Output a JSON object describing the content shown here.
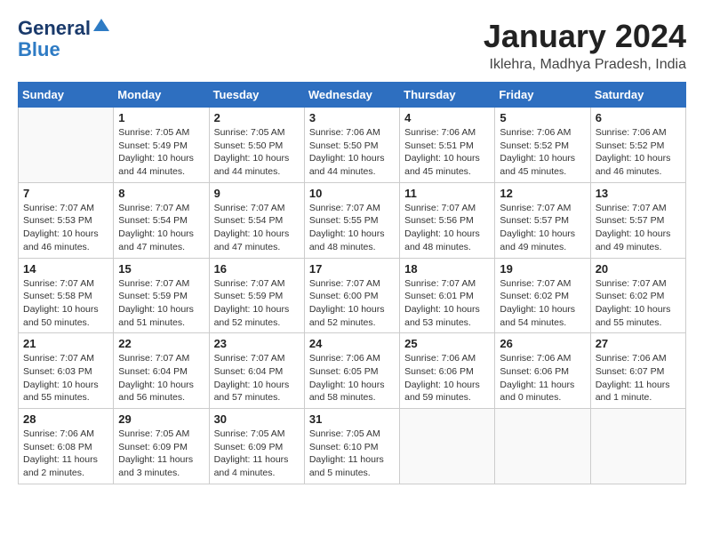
{
  "logo": {
    "line1": "General",
    "line2": "Blue"
  },
  "title": "January 2024",
  "subtitle": "Iklehra, Madhya Pradesh, India",
  "days": [
    "Sunday",
    "Monday",
    "Tuesday",
    "Wednesday",
    "Thursday",
    "Friday",
    "Saturday"
  ],
  "weeks": [
    [
      {
        "date": "",
        "sunrise": "",
        "sunset": "",
        "daylight": ""
      },
      {
        "date": "1",
        "sunrise": "Sunrise: 7:05 AM",
        "sunset": "Sunset: 5:49 PM",
        "daylight": "Daylight: 10 hours and 44 minutes."
      },
      {
        "date": "2",
        "sunrise": "Sunrise: 7:05 AM",
        "sunset": "Sunset: 5:50 PM",
        "daylight": "Daylight: 10 hours and 44 minutes."
      },
      {
        "date": "3",
        "sunrise": "Sunrise: 7:06 AM",
        "sunset": "Sunset: 5:50 PM",
        "daylight": "Daylight: 10 hours and 44 minutes."
      },
      {
        "date": "4",
        "sunrise": "Sunrise: 7:06 AM",
        "sunset": "Sunset: 5:51 PM",
        "daylight": "Daylight: 10 hours and 45 minutes."
      },
      {
        "date": "5",
        "sunrise": "Sunrise: 7:06 AM",
        "sunset": "Sunset: 5:52 PM",
        "daylight": "Daylight: 10 hours and 45 minutes."
      },
      {
        "date": "6",
        "sunrise": "Sunrise: 7:06 AM",
        "sunset": "Sunset: 5:52 PM",
        "daylight": "Daylight: 10 hours and 46 minutes."
      }
    ],
    [
      {
        "date": "7",
        "sunrise": "Sunrise: 7:07 AM",
        "sunset": "Sunset: 5:53 PM",
        "daylight": "Daylight: 10 hours and 46 minutes."
      },
      {
        "date": "8",
        "sunrise": "Sunrise: 7:07 AM",
        "sunset": "Sunset: 5:54 PM",
        "daylight": "Daylight: 10 hours and 47 minutes."
      },
      {
        "date": "9",
        "sunrise": "Sunrise: 7:07 AM",
        "sunset": "Sunset: 5:54 PM",
        "daylight": "Daylight: 10 hours and 47 minutes."
      },
      {
        "date": "10",
        "sunrise": "Sunrise: 7:07 AM",
        "sunset": "Sunset: 5:55 PM",
        "daylight": "Daylight: 10 hours and 48 minutes."
      },
      {
        "date": "11",
        "sunrise": "Sunrise: 7:07 AM",
        "sunset": "Sunset: 5:56 PM",
        "daylight": "Daylight: 10 hours and 48 minutes."
      },
      {
        "date": "12",
        "sunrise": "Sunrise: 7:07 AM",
        "sunset": "Sunset: 5:57 PM",
        "daylight": "Daylight: 10 hours and 49 minutes."
      },
      {
        "date": "13",
        "sunrise": "Sunrise: 7:07 AM",
        "sunset": "Sunset: 5:57 PM",
        "daylight": "Daylight: 10 hours and 49 minutes."
      }
    ],
    [
      {
        "date": "14",
        "sunrise": "Sunrise: 7:07 AM",
        "sunset": "Sunset: 5:58 PM",
        "daylight": "Daylight: 10 hours and 50 minutes."
      },
      {
        "date": "15",
        "sunrise": "Sunrise: 7:07 AM",
        "sunset": "Sunset: 5:59 PM",
        "daylight": "Daylight: 10 hours and 51 minutes."
      },
      {
        "date": "16",
        "sunrise": "Sunrise: 7:07 AM",
        "sunset": "Sunset: 5:59 PM",
        "daylight": "Daylight: 10 hours and 52 minutes."
      },
      {
        "date": "17",
        "sunrise": "Sunrise: 7:07 AM",
        "sunset": "Sunset: 6:00 PM",
        "daylight": "Daylight: 10 hours and 52 minutes."
      },
      {
        "date": "18",
        "sunrise": "Sunrise: 7:07 AM",
        "sunset": "Sunset: 6:01 PM",
        "daylight": "Daylight: 10 hours and 53 minutes."
      },
      {
        "date": "19",
        "sunrise": "Sunrise: 7:07 AM",
        "sunset": "Sunset: 6:02 PM",
        "daylight": "Daylight: 10 hours and 54 minutes."
      },
      {
        "date": "20",
        "sunrise": "Sunrise: 7:07 AM",
        "sunset": "Sunset: 6:02 PM",
        "daylight": "Daylight: 10 hours and 55 minutes."
      }
    ],
    [
      {
        "date": "21",
        "sunrise": "Sunrise: 7:07 AM",
        "sunset": "Sunset: 6:03 PM",
        "daylight": "Daylight: 10 hours and 55 minutes."
      },
      {
        "date": "22",
        "sunrise": "Sunrise: 7:07 AM",
        "sunset": "Sunset: 6:04 PM",
        "daylight": "Daylight: 10 hours and 56 minutes."
      },
      {
        "date": "23",
        "sunrise": "Sunrise: 7:07 AM",
        "sunset": "Sunset: 6:04 PM",
        "daylight": "Daylight: 10 hours and 57 minutes."
      },
      {
        "date": "24",
        "sunrise": "Sunrise: 7:06 AM",
        "sunset": "Sunset: 6:05 PM",
        "daylight": "Daylight: 10 hours and 58 minutes."
      },
      {
        "date": "25",
        "sunrise": "Sunrise: 7:06 AM",
        "sunset": "Sunset: 6:06 PM",
        "daylight": "Daylight: 10 hours and 59 minutes."
      },
      {
        "date": "26",
        "sunrise": "Sunrise: 7:06 AM",
        "sunset": "Sunset: 6:06 PM",
        "daylight": "Daylight: 11 hours and 0 minutes."
      },
      {
        "date": "27",
        "sunrise": "Sunrise: 7:06 AM",
        "sunset": "Sunset: 6:07 PM",
        "daylight": "Daylight: 11 hours and 1 minute."
      }
    ],
    [
      {
        "date": "28",
        "sunrise": "Sunrise: 7:06 AM",
        "sunset": "Sunset: 6:08 PM",
        "daylight": "Daylight: 11 hours and 2 minutes."
      },
      {
        "date": "29",
        "sunrise": "Sunrise: 7:05 AM",
        "sunset": "Sunset: 6:09 PM",
        "daylight": "Daylight: 11 hours and 3 minutes."
      },
      {
        "date": "30",
        "sunrise": "Sunrise: 7:05 AM",
        "sunset": "Sunset: 6:09 PM",
        "daylight": "Daylight: 11 hours and 4 minutes."
      },
      {
        "date": "31",
        "sunrise": "Sunrise: 7:05 AM",
        "sunset": "Sunset: 6:10 PM",
        "daylight": "Daylight: 11 hours and 5 minutes."
      },
      {
        "date": "",
        "sunrise": "",
        "sunset": "",
        "daylight": ""
      },
      {
        "date": "",
        "sunrise": "",
        "sunset": "",
        "daylight": ""
      },
      {
        "date": "",
        "sunrise": "",
        "sunset": "",
        "daylight": ""
      }
    ]
  ]
}
